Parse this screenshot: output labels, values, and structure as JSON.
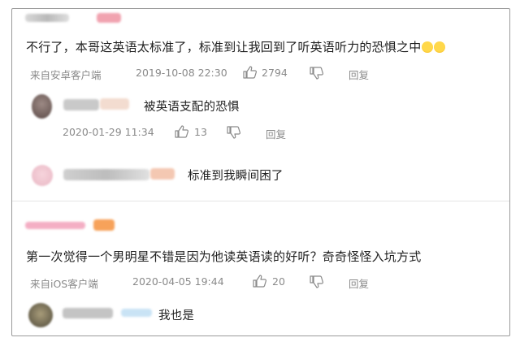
{
  "comments": [
    {
      "text": "不行了，本哥这英语太标准了，标准到让我回到了听英语听力的恐惧之中",
      "emoji": "😂😂",
      "source": "来自安卓客户端",
      "time": "2019-10-08 22:30",
      "likes": "2794",
      "reply_label": "回复",
      "replies": [
        {
          "text": "被英语支配的恐惧",
          "time": "2020-01-29 11:34",
          "likes": "13",
          "reply_label": "回复"
        },
        {
          "text": "标准到我瞬间困了"
        }
      ]
    },
    {
      "text": "第一次觉得一个男明星不错是因为他读英语读的好听？奇奇怪怪入坑方式",
      "source": "来自iOS客户端",
      "time": "2020-04-05 19:44",
      "likes": "20",
      "reply_label": "回复",
      "replies": [
        {
          "text": "我也是"
        }
      ]
    }
  ],
  "icons": {
    "like": "thumbs-up-icon",
    "dislike": "thumbs-down-icon",
    "emoji": "laughing-tears-emoji"
  },
  "colors": {
    "meta_text": "#8a8a8a",
    "border": "#9a9a9a",
    "divider": "#e4e4e4"
  }
}
